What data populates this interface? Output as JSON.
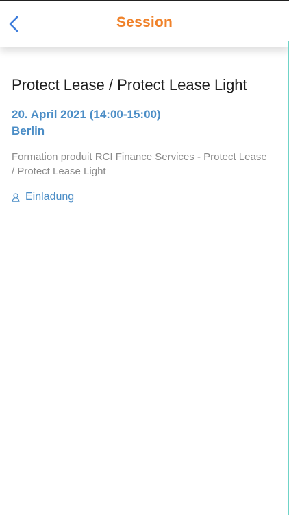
{
  "header": {
    "title": "Session",
    "back_icon": "chevron-left-icon",
    "accent_color": "#f0822a"
  },
  "session": {
    "title": "Protect Lease / Protect Lease Light",
    "date": "20. April 2021 (14:00-15:00)",
    "location": "Berlin",
    "description": "Formation produit RCI Finance Services - Protect Lease / Protect Lease Light",
    "invite_label": "Einladung",
    "invite_icon": "user-icon",
    "link_color": "#4b8dc6"
  }
}
